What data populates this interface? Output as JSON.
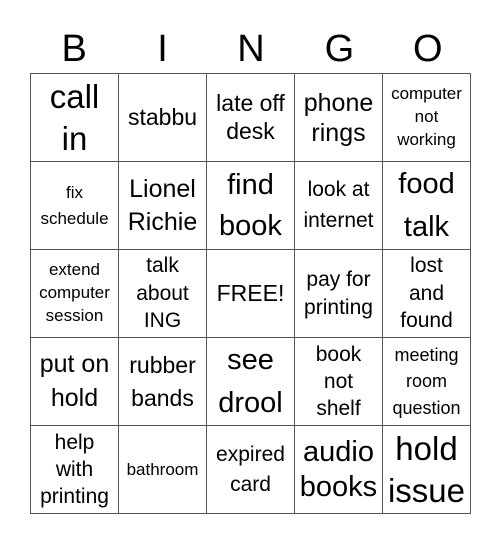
{
  "header": {
    "letters": [
      "B",
      "I",
      "N",
      "G",
      "O"
    ]
  },
  "cells": [
    [
      "call in",
      "stabbu",
      "late off desk",
      "phone rings",
      "computer not working"
    ],
    [
      "fix schedule",
      "Lionel Richie",
      "find book",
      "look at internet",
      "food talk"
    ],
    [
      "extend computer session",
      "talk about ING",
      "FREE!",
      "pay for printing",
      "lost and found"
    ],
    [
      "put on hold",
      "rubber bands",
      "see drool",
      "book not shelf",
      "meeting room question"
    ],
    [
      "help with printing",
      "bathroom",
      "expired card",
      "audio books",
      "hold issue"
    ]
  ]
}
